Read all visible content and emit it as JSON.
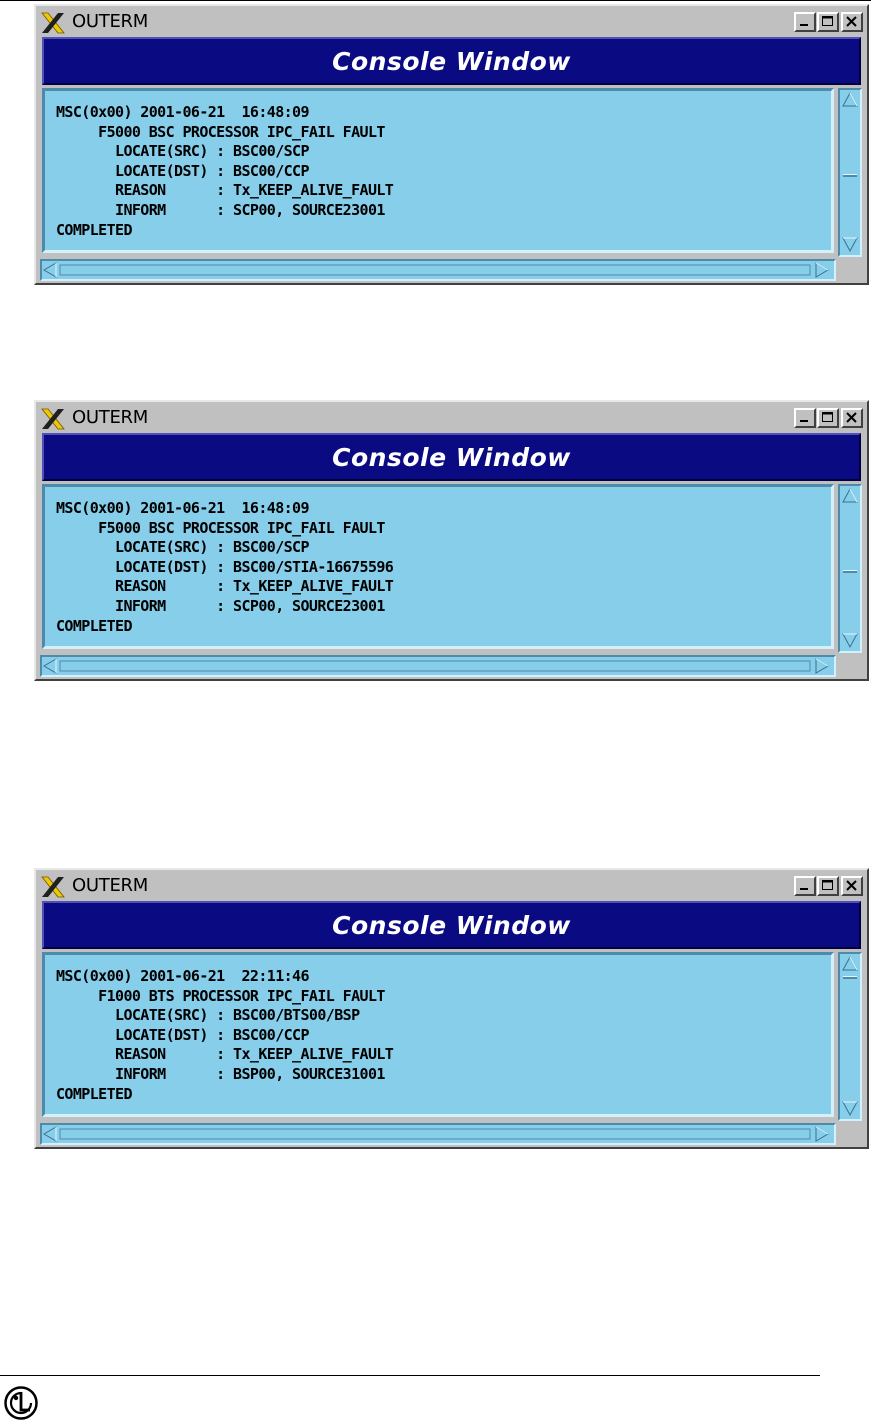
{
  "windows": [
    {
      "title": "OUTERM",
      "banner": "Console Window",
      "lines": [
        "MSC(0x00) 2001-06-21  16:48:09",
        "     F5000 BSC PROCESSOR IPC_FAIL FAULT",
        "       LOCATE(SRC) : BSC00/SCP",
        "       LOCATE(DST) : BSC00/CCP",
        "       REASON      : Tx_KEEP_ALIVE_FAULT",
        "       INFORM      : SCP00, SOURCE23001",
        "COMPLETED"
      ]
    },
    {
      "title": "OUTERM",
      "banner": "Console Window",
      "lines": [
        "MSC(0x00) 2001-06-21  16:48:09",
        "     F5000 BSC PROCESSOR IPC_FAIL FAULT",
        "       LOCATE(SRC) : BSC00/SCP",
        "       LOCATE(DST) : BSC00/STIA-16675596",
        "       REASON      : Tx_KEEP_ALIVE_FAULT",
        "       INFORM      : SCP00, SOURCE23001",
        "COMPLETED"
      ]
    },
    {
      "title": "OUTERM",
      "banner": "Console Window",
      "lines": [
        "MSC(0x00) 2001-06-21  22:11:46",
        "     F1000 BTS PROCESSOR IPC_FAIL FAULT",
        "       LOCATE(SRC) : BSC00/BTS00/BSP",
        "       LOCATE(DST) : BSC00/CCP",
        "       REASON      : Tx_KEEP_ALIVE_FAULT",
        "       INFORM      : BSP00, SOURCE31001",
        "COMPLETED"
      ]
    }
  ],
  "icons": {
    "window_logo": "x-logo-icon",
    "minimize": "minimize-icon",
    "maximize": "maximize-icon",
    "close": "close-icon",
    "footer_logo": "lg-logo-icon"
  },
  "colors": {
    "banner_bg": "#0a0a82",
    "console_bg": "#87ceeb",
    "window_frame": "#c0c0c0",
    "logo_yellow": "#f0c800"
  }
}
